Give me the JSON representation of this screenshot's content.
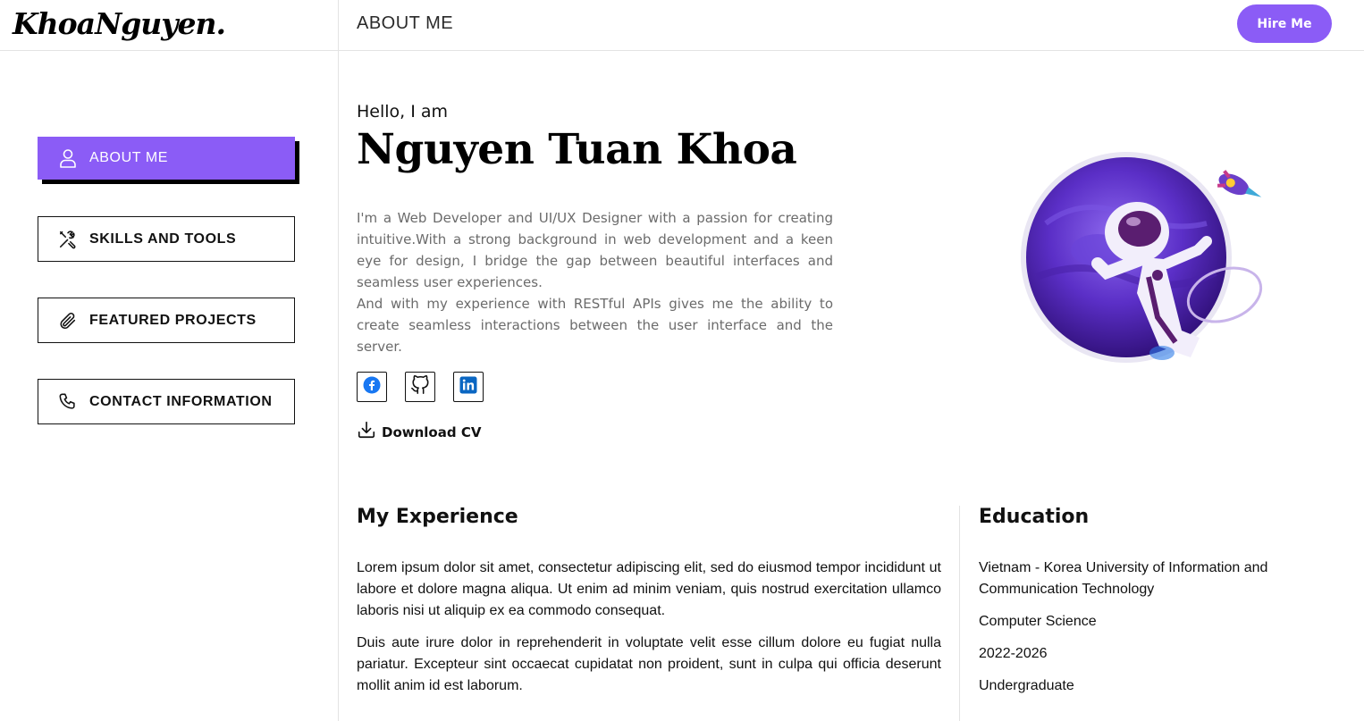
{
  "header": {
    "logo": "KhoaNguyen.",
    "page_title": "ABOUT ME",
    "hire_label": "Hire Me"
  },
  "colors": {
    "accent": "#8b5cf6",
    "text": "#111111",
    "muted": "#6b6b6b",
    "facebook": "#1877f2",
    "linkedin": "#0a66c2"
  },
  "nav": {
    "items": [
      {
        "label": "ABOUT ME",
        "icon": "user-icon",
        "active": true
      },
      {
        "label": "SKILLS AND TOOLS",
        "icon": "tools-icon",
        "active": false
      },
      {
        "label": "FEATURED PROJECTS",
        "icon": "paperclip-icon",
        "active": false
      },
      {
        "label": "CONTACT INFORMATION",
        "icon": "phone-icon",
        "active": false
      }
    ]
  },
  "intro": {
    "greeting": "Hello, I am",
    "name": "Nguyen Tuan Khoa",
    "bio_1": "I'm a Web Developer and UI/UX Designer with a passion for creating intuitive.With a strong background in web development and a keen eye for design, I bridge the gap between beautiful interfaces and seamless user experiences.",
    "bio_2": "And with my experience with RESTful APIs gives me the ability to create seamless interactions between the user interface and the server.",
    "socials": [
      {
        "icon": "facebook-icon"
      },
      {
        "icon": "github-icon"
      },
      {
        "icon": "linkedin-icon"
      }
    ],
    "download_label": "Download CV"
  },
  "experience": {
    "title": "My Experience",
    "paragraphs": [
      "Lorem ipsum dolor sit amet, consectetur adipiscing elit, sed do eiusmod tempor incididunt ut labore et dolore magna aliqua. Ut enim ad minim veniam, quis nostrud exercitation ullamco laboris nisi ut aliquip ex ea commodo consequat.",
      "Duis aute irure dolor in reprehenderit in voluptate velit esse cillum dolore eu fugiat nulla pariatur. Excepteur sint occaecat cupidatat non proident, sunt in culpa qui officia deserunt mollit anim id est laborum."
    ]
  },
  "education": {
    "title": "Education",
    "school": "Vietnam - Korea University of Information and Communication Technology",
    "major": "Computer Science",
    "years": "2022-2026",
    "level": "Undergraduate"
  }
}
